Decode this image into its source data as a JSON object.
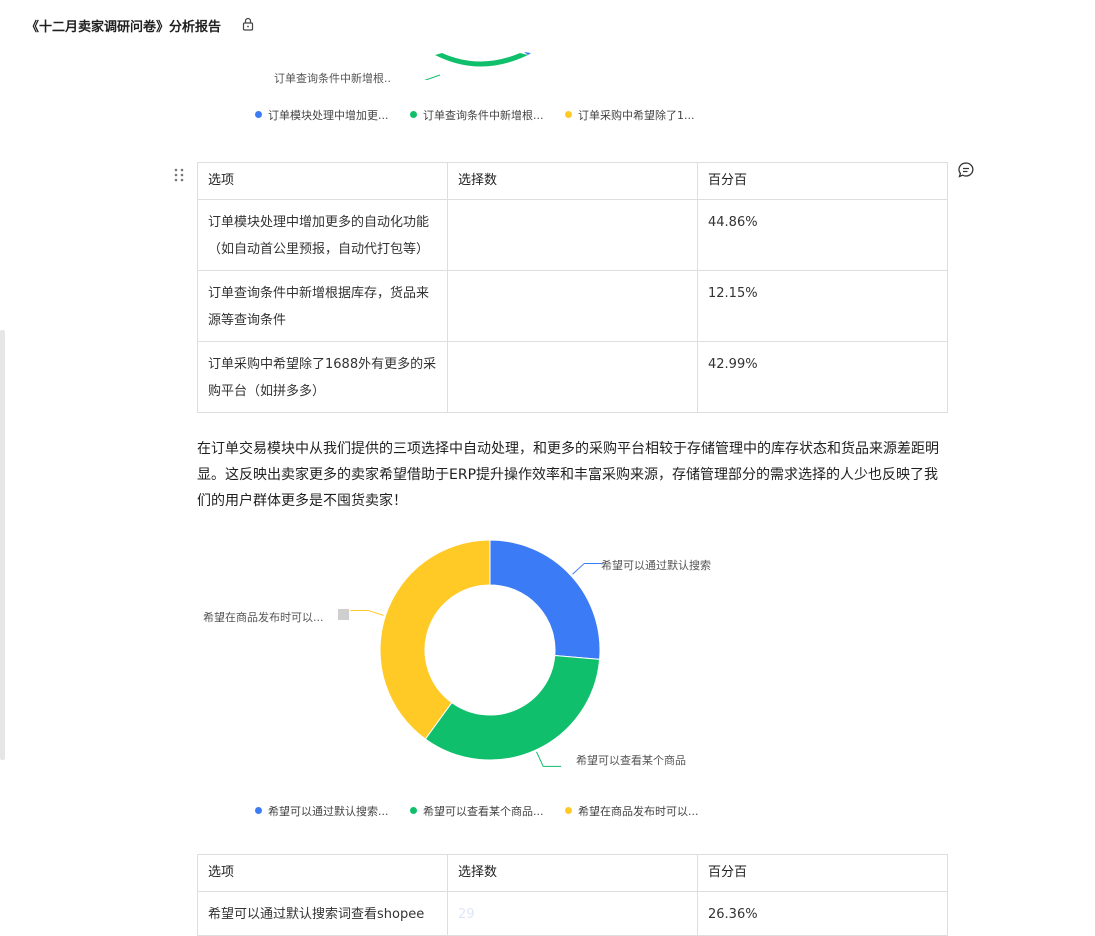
{
  "header": {
    "title": "《十二月卖家调研问卷》分析报告"
  },
  "chart1": {
    "label": "订单查询条件中新增根..",
    "legend": [
      {
        "name": "订单模块处理中增加更...",
        "color": "#3c7bf6"
      },
      {
        "name": "订单查询条件中新增根...",
        "color": "#0fbf6b"
      },
      {
        "name": "订单采购中希望除了1...",
        "color": "#ffc926"
      }
    ]
  },
  "table1": {
    "headers": [
      "选项",
      "选择数",
      "百分百"
    ],
    "rows": [
      {
        "option": "订单模块处理中增加更多的自动化功能（如自动首公里预报，自动代打包等）",
        "count": "",
        "percent": "44.86%"
      },
      {
        "option": "订单查询条件中新增根据库存，货品来源等查询条件",
        "count": "",
        "percent": "12.15%"
      },
      {
        "option": "订单采购中希望除了1688外有更多的采购平台（如拼多多）",
        "count": "",
        "percent": "42.99%"
      }
    ]
  },
  "paragraph": "在订单交易模块中从我们提供的三项选择中自动处理，和更多的采购平台相较于存储管理中的库存状态和货品来源差距明显。这反映出卖家更多的卖家希望借助于ERP提升操作效率和丰富采购来源，存储管理部分的需求选择的人少也反映了我们的用户群体更多是不囤货卖家！",
  "chart_data": {
    "type": "pie",
    "categories": [
      "希望可以通过默认搜索...",
      "希望可以查看某个商品...",
      "希望在商品发布时可以..."
    ],
    "values": [
      26.36,
      33.64,
      40.0
    ],
    "colors": [
      "#3c7bf6",
      "#0fbf6b",
      "#ffc926"
    ],
    "callouts": [
      "希望可以通过默认搜索",
      "希望可以查看某个商品",
      "希望在商品发布时可以..."
    ],
    "donut": true
  },
  "table2": {
    "headers": [
      "选项",
      "选择数",
      "百分百"
    ],
    "rows": [
      {
        "option": "希望可以通过默认搜索词查看shopee",
        "count": "29",
        "percent": "26.36%"
      }
    ]
  }
}
